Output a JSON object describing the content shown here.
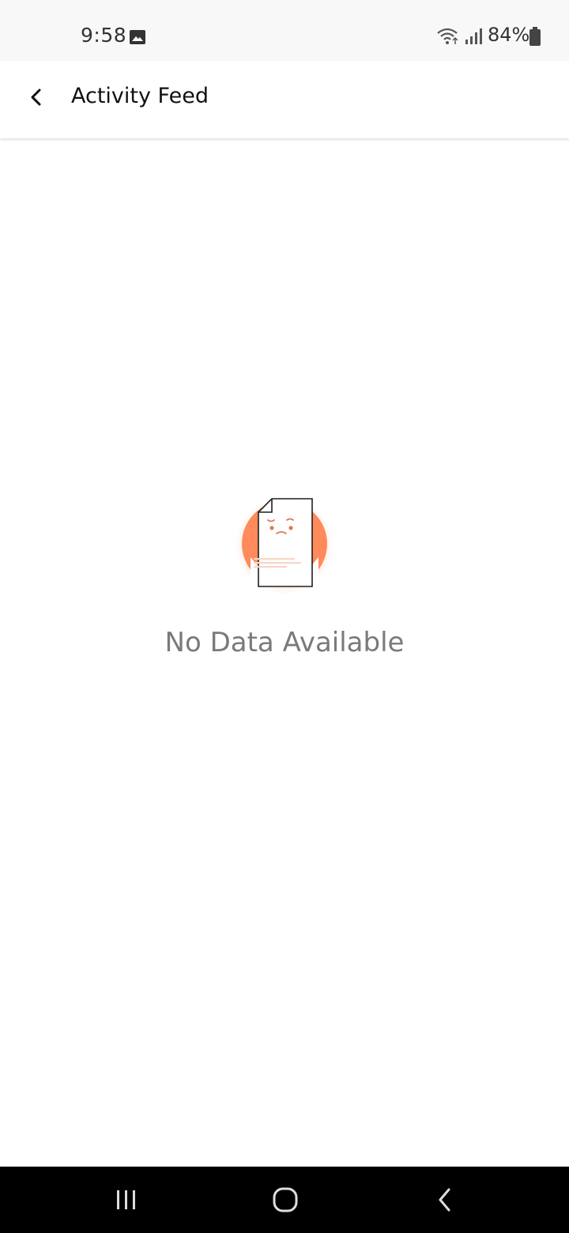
{
  "status_bar": {
    "time": "9:58",
    "battery": "84%",
    "icons": [
      "gallery-icon",
      "wifi-icon",
      "signal-icon",
      "battery-icon"
    ]
  },
  "app_bar": {
    "title": "Activity Feed",
    "back_icon": "chevron-left-icon"
  },
  "empty_state": {
    "message": "No Data Available",
    "illustration": "sad-document-icon",
    "accent_color": "#ff8a5b"
  },
  "nav_bar": {
    "buttons": [
      "recent-apps-icon",
      "home-icon",
      "back-icon"
    ]
  }
}
